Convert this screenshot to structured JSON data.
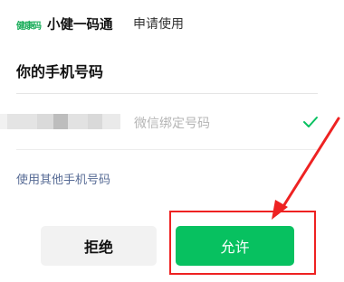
{
  "header": {
    "logo_text": "健康码",
    "app_name": "小健一码通",
    "request_text": "申请使用"
  },
  "title": "你的手机号码",
  "phone_option": {
    "masked_number": "",
    "label": "微信绑定号码",
    "selected": true,
    "check_icon": "check-icon"
  },
  "other_phone_link": "使用其他手机号码",
  "buttons": {
    "reject": "拒绝",
    "allow": "允许"
  },
  "colors": {
    "accent_green": "#07c160",
    "link_blue": "#576b95",
    "annotation_red": "#ee2222"
  }
}
